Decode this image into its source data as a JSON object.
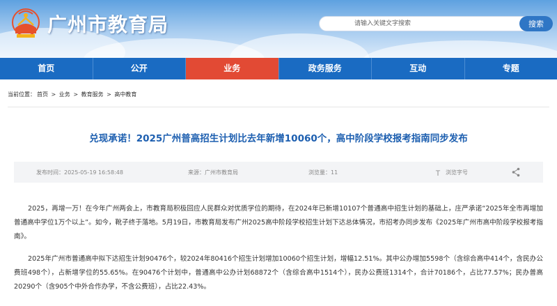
{
  "header": {
    "site_title": "广州市教育局",
    "search_placeholder": "请输入关键文字搜索",
    "search_button": "搜索"
  },
  "nav": {
    "items": [
      {
        "label": "首页"
      },
      {
        "label": "公开"
      },
      {
        "label": "业务"
      },
      {
        "label": "政务服务"
      },
      {
        "label": "互动"
      },
      {
        "label": "专题"
      }
    ],
    "active_index": 2
  },
  "breadcrumb": {
    "prefix": "当前位置：",
    "items": [
      "首页",
      "业务",
      "教育服务",
      "高中教育"
    ],
    "separator": ">"
  },
  "article": {
    "title": "兑现承诺！2025广州普高招生计划比去年新增10060个，高中阶段学校报考指南同步发布",
    "meta": {
      "published_label": "发布时间：",
      "published": "2025-05-19 16:58:48",
      "source_label": "来源：",
      "source": "广州市教育局",
      "views_label": "浏览量：",
      "views": "11",
      "font_label": "浏览字号"
    },
    "paragraphs": [
      "2025，再增一万！在今年广州两会上，市教育局积极回应人民群众对优质学位的期待，在2024年已新增10107个普通高中招生计划的基础上，庄严承诺“2025年全市再增加普通高中学位1万个以上”。如今，靴子终于落地。5月19日，市教育局发布广州2025高中阶段学校招生计划下达总体情况，市招考办同步发布《2025年广州市高中阶段学校报考指南》。",
      "2025年广州市普通高中拟下达招生计划90476个，较2024年80416个招生计划增加10060个招生计划，增幅12.51%。其中公办增加5598个（含综合高中414个，含民办公费班498个），占新增学位的55.65%。在90476个计划中，普通高中公办计划68872个（含综合高中1514个），民办公费班1314个，合计70186个，占比77.57%；民办普高20290个（含905个中外合作办学，不含公费班），占比22.43%。"
    ]
  },
  "colors": {
    "nav_bg": "#1a6bc2",
    "nav_active": "#e24a34",
    "title": "#1d5fb0",
    "search_button": "#2f76c5"
  }
}
